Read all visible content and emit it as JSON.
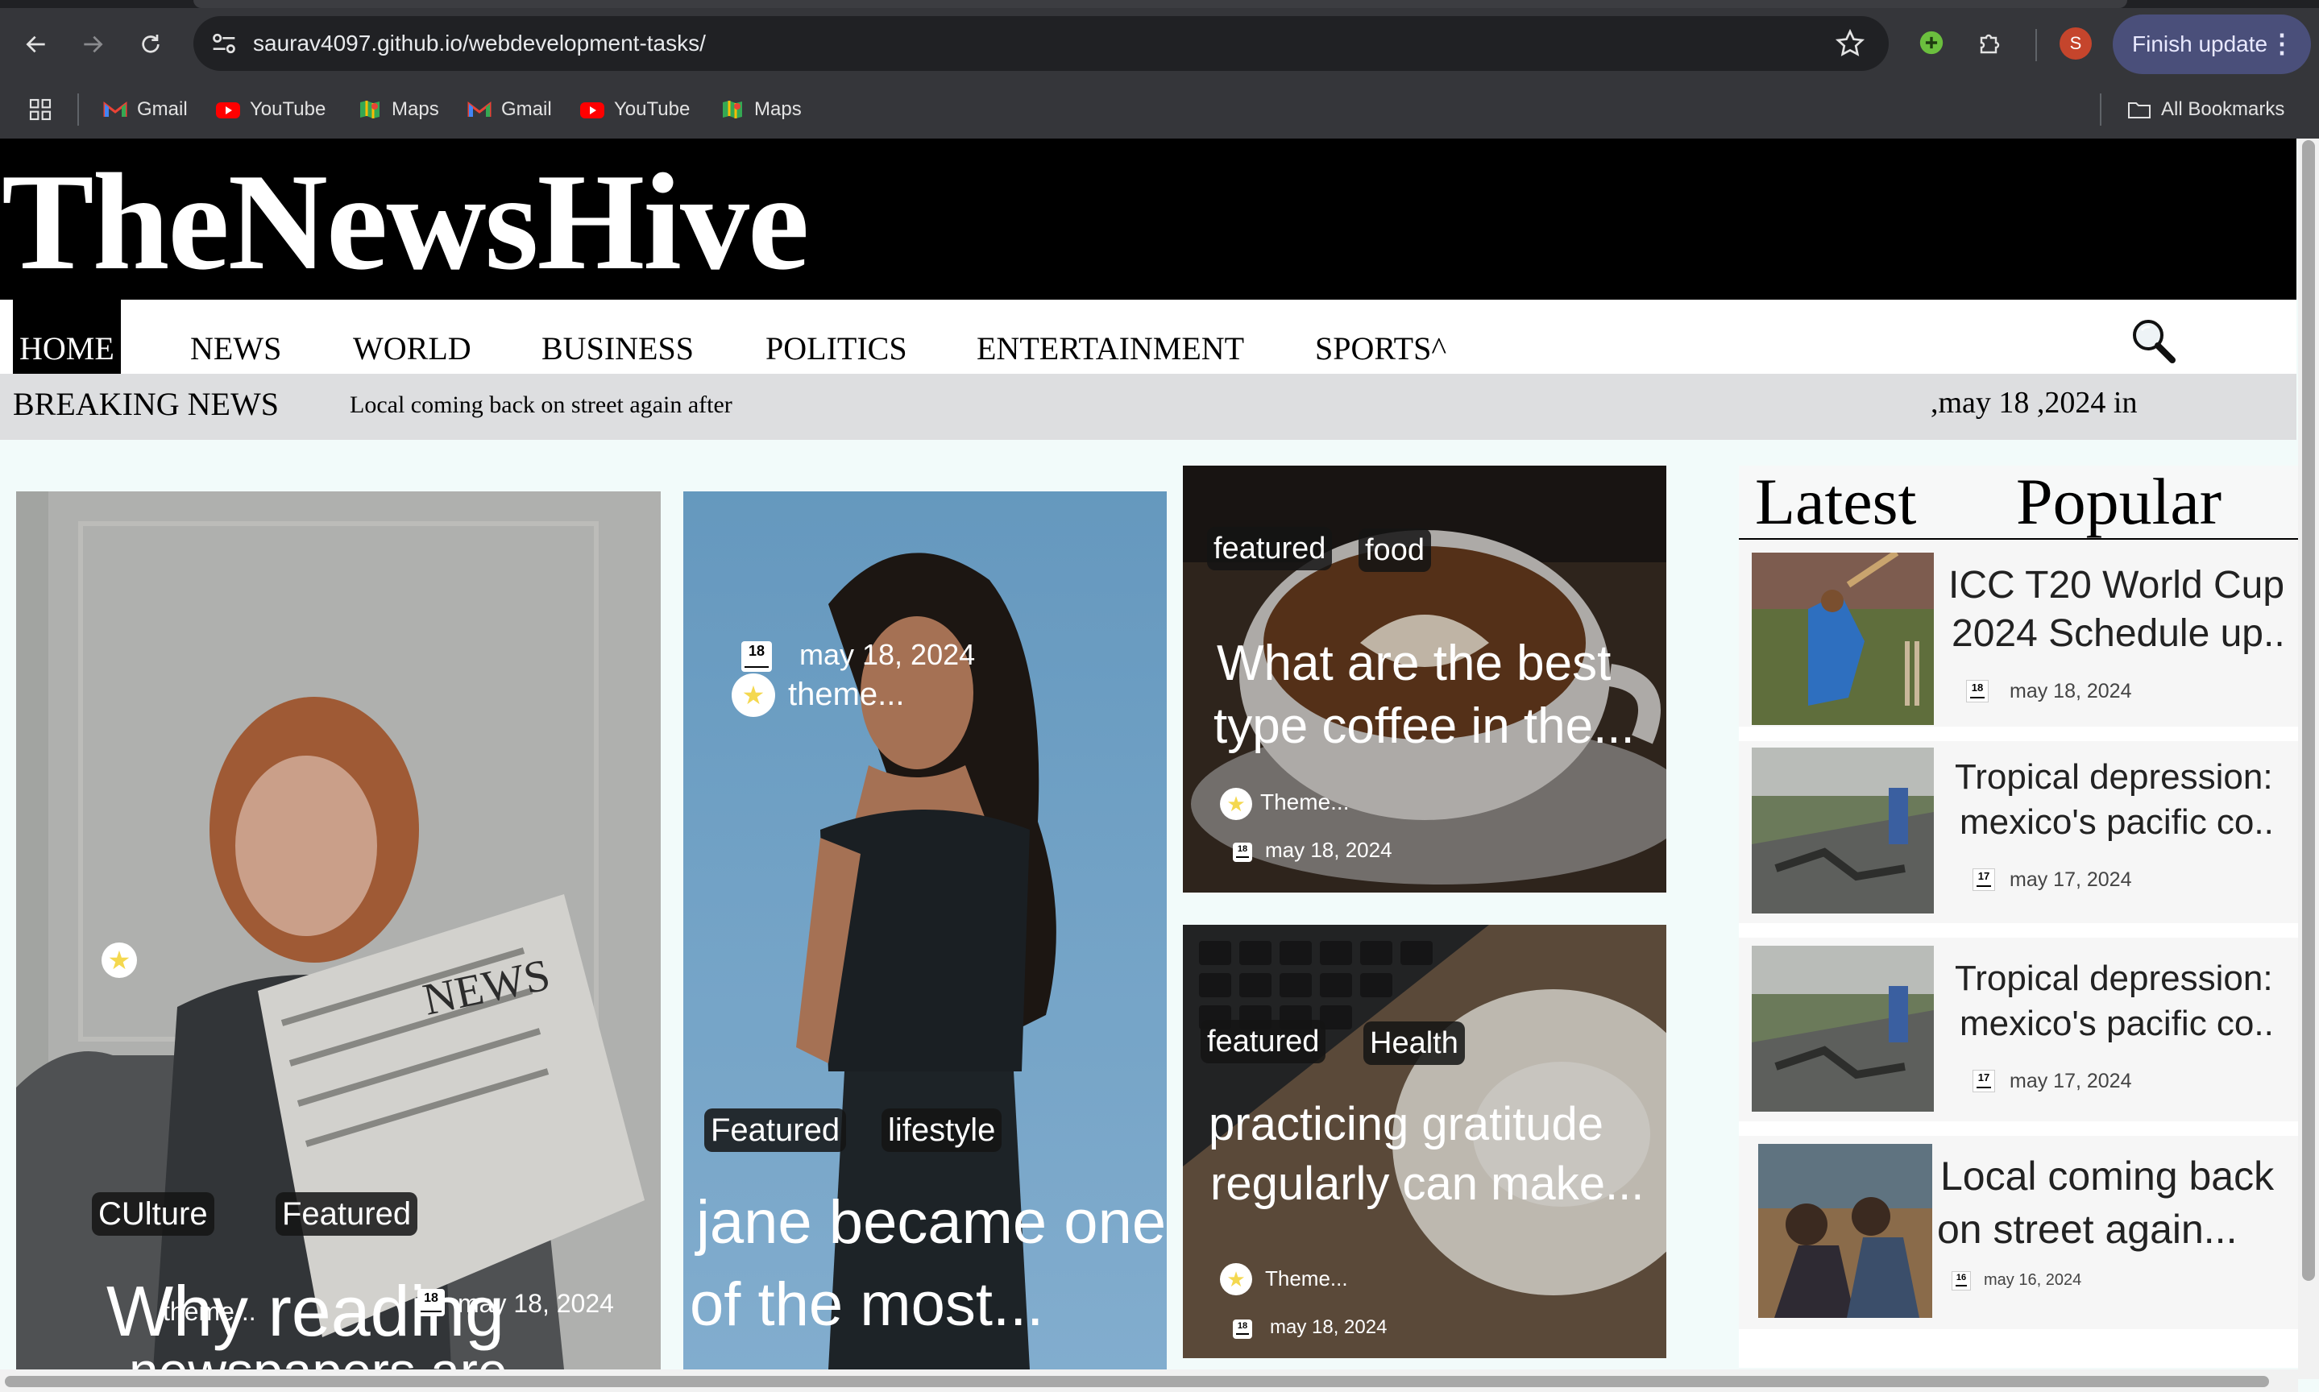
{
  "browser": {
    "url": "saurav4097.github.io/webdevelopment-tasks/",
    "profile_initial": "S",
    "finish_update": "Finish update",
    "bookmarks": [
      {
        "label": "Gmail",
        "icon": "gmail-icon"
      },
      {
        "label": "YouTube",
        "icon": "youtube-icon"
      },
      {
        "label": "Maps",
        "icon": "maps-icon"
      },
      {
        "label": "Gmail",
        "icon": "gmail-icon"
      },
      {
        "label": "YouTube",
        "icon": "youtube-icon"
      },
      {
        "label": "Maps",
        "icon": "maps-icon"
      }
    ],
    "all_bookmarks": "All Bookmarks"
  },
  "site": {
    "logo": "TheNewsHive",
    "nav": [
      "HOME",
      "NEWS",
      "WORLD",
      "BUSINESS",
      "POLITICS",
      "ENTERTAINMENT",
      "SPORTS^"
    ],
    "breaking_label": "BREAKING NEWS",
    "breaking_text": "Local coming back on street again after",
    "breaking_date": ",may 18 ,2024 in"
  },
  "cards": [
    {
      "tags": [
        "CUlture",
        "Featured"
      ],
      "title1": "Why reading",
      "title2": "newspapers are...",
      "author": "theme...",
      "day": "18",
      "date": "may 18, 2024"
    },
    {
      "tags": [
        "Featured",
        "lifestyle"
      ],
      "title1": "jane became one",
      "title2": "of the most...",
      "author": "theme...",
      "day": "18",
      "date": "may 18, 2024"
    },
    {
      "tags": [
        "featured",
        "food"
      ],
      "title1": "What are the best",
      "title2": "type coffee in the...",
      "author": "Theme...",
      "day": "18",
      "date": "may 18, 2024"
    },
    {
      "tags": [
        "featured",
        "Health"
      ],
      "title1": "practicing gratitude",
      "title2": "regularly can make...",
      "author": "Theme...",
      "day": "18",
      "date": "may 18, 2024"
    }
  ],
  "sidebar": {
    "tabs": [
      "Latest",
      "Popular"
    ],
    "items": [
      {
        "title1": "ICC T20 World Cup",
        "title2": "2024 Schedule up..",
        "day": "18",
        "date": "may 18, 2024"
      },
      {
        "title1": "Tropical depression:",
        "title2": "mexico's pacific co..",
        "day": "17",
        "date": "may 17, 2024"
      },
      {
        "title1": "Tropical depression:",
        "title2": "mexico's pacific co..",
        "day": "17",
        "date": "may 17, 2024"
      },
      {
        "title1": "Local coming back",
        "title2": "on street again...",
        "day": "16",
        "date": "may 16, 2024"
      }
    ]
  },
  "colors": {
    "masthead": "#000000",
    "breaking_bar": "#dddee0",
    "page_bg": "#f2fbfa",
    "browser_chrome": "#35363a"
  }
}
